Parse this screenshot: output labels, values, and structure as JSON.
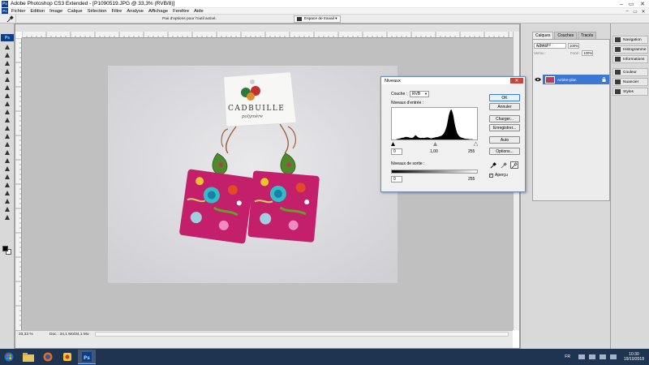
{
  "window": {
    "title": "Adobe Photoshop CS3 Extended - [P1090519.JPG @ 33,3% (RVB/8)]",
    "app_badge": "Ps",
    "min": "–",
    "max": "▭",
    "close": "✕"
  },
  "menu": {
    "items": [
      "Fichier",
      "Edition",
      "Image",
      "Calque",
      "Sélection",
      "Filtre",
      "Analyse",
      "Affichage",
      "Fenêtre",
      "Aide"
    ],
    "doc_min": "–",
    "doc_max": "▭",
    "doc_close": "✕"
  },
  "options_bar": {
    "hint": "Pas d'options pour l'outil activé.",
    "workspace": "Espace de travail ▾"
  },
  "document": {
    "zoom": "33,33 %",
    "info": "Doc : 34,1 Mo/34,1 Mo"
  },
  "photo": {
    "card_brand": "CADBUILLE",
    "card_sub": "polymère"
  },
  "layers_panel": {
    "tabs": [
      "Calques",
      "Couches",
      "Tracés"
    ],
    "blend_mode": "Normal",
    "opacity_label": "Opacité :",
    "opacity_value": "100%",
    "lock_label": "Verrou :",
    "fill_label": "Fond :",
    "fill_value": "100%",
    "layer_name": "Arrière-plan"
  },
  "dock": {
    "items": [
      "Navigation",
      "Histogramme",
      "Informations",
      "Couleur",
      "Nuancier",
      "Styles"
    ]
  },
  "levels_dialog": {
    "title": "Niveaux",
    "close": "✕",
    "couche_label": "Couche :",
    "couche_value": "RVB",
    "input_label": "Niveaux d'entrée :",
    "input_black": "0",
    "input_gamma": "1,00",
    "input_white": "255",
    "output_label": "Niveaux de sortie :",
    "output_black": "0",
    "output_white": "255",
    "buttons": {
      "ok": "OK",
      "cancel": "Annuler",
      "load": "Charger...",
      "save": "Enregistrer...",
      "auto": "Auto",
      "options": "Options..."
    },
    "preview_label": "Aperçu",
    "histogram": [
      0,
      0,
      0,
      0,
      0,
      1,
      2,
      3,
      3,
      4,
      5,
      6,
      6,
      7,
      8,
      9,
      8,
      8,
      7,
      6,
      6,
      5,
      6,
      8,
      11,
      15,
      12,
      9,
      7,
      6,
      5,
      5,
      6,
      5,
      5,
      6,
      6,
      7,
      7,
      6,
      5,
      4,
      4,
      5,
      6,
      6,
      7,
      8,
      8,
      9,
      10,
      11,
      12,
      14,
      17,
      21,
      27,
      35,
      45,
      60,
      78,
      90,
      98,
      100,
      92,
      80,
      60,
      44,
      32,
      22,
      16,
      12,
      9,
      7,
      6,
      5,
      4,
      3,
      3,
      2,
      2,
      2,
      1,
      1,
      1,
      1,
      0,
      0,
      0,
      0
    ]
  },
  "taskbar": {
    "lang": "FR",
    "time": "10:30",
    "date": "19/10/2018"
  }
}
